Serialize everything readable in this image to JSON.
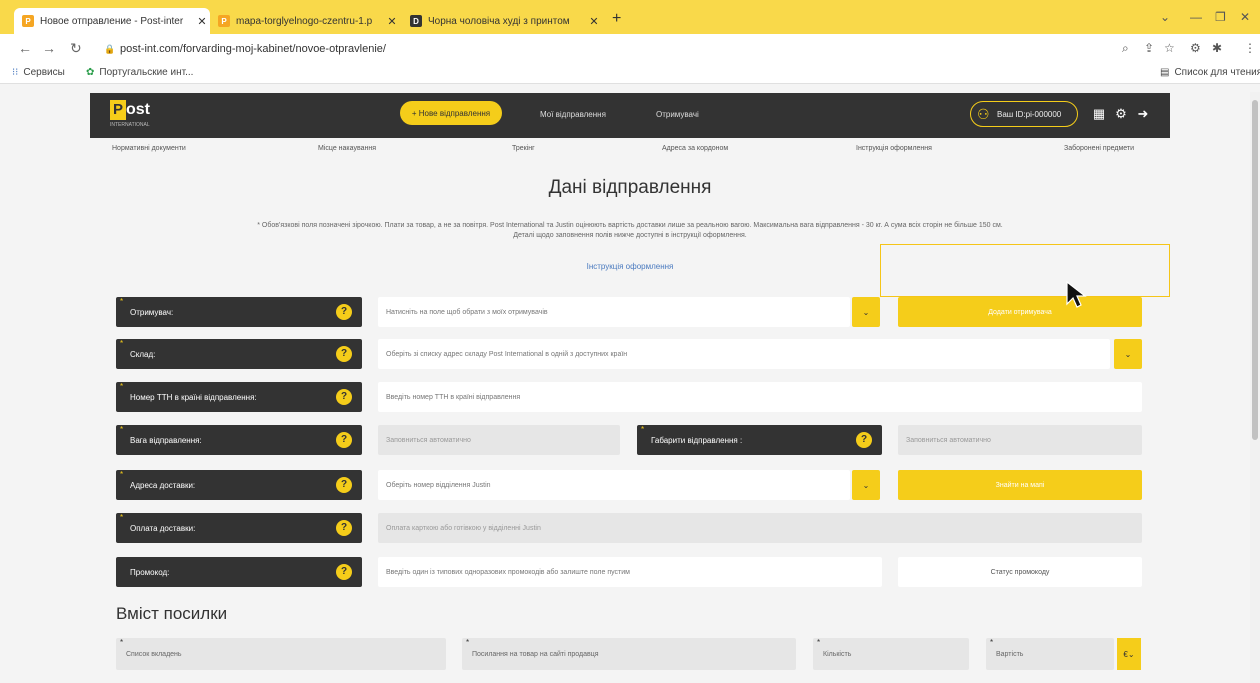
{
  "browser": {
    "tabs": [
      {
        "title": "Новое отправление - Post-inter",
        "favicon": "P"
      },
      {
        "title": "mapa-torglyelnogo-czentru-1.p",
        "favicon": "P"
      },
      {
        "title": "Чорна чоловіча худі з принтом",
        "favicon": "D"
      }
    ],
    "new_tab": "+",
    "url": "post-int.com/forvarding-moj-kabinet/novoe-otpravlenie/",
    "bookmarks": [
      {
        "label": "Сервисы"
      },
      {
        "label": "Португальские инт..."
      }
    ],
    "reading_list": "Список для чтения"
  },
  "site": {
    "logo_p": "P",
    "logo_rest": "ost",
    "logo_sub": "INTERNATIONAL",
    "nav_new": "+ Нове відправлення",
    "nav_mine": "Мої відправлення",
    "nav_received": "Отримувачі",
    "user_id": "Ваш ID:pi-000000",
    "subnav": [
      "Нормативні документи",
      "Місце накаування",
      "Трекінг",
      "Адреса за кордоном",
      "Інструкція оформлення",
      "Заборонені предмети"
    ]
  },
  "page": {
    "title": "Дані відправлення",
    "notice_line1": "* Обов'язкові поля позначені зірочкою. Плати за товар, а не за повітря. Post International та Justin оцінюють вартість доставки лише за реальною вагою. Максимальна вага відправлення - 30 кг. А сума всіх сторін не більше 150 см.",
    "notice_line2": "Деталі щодо заповнення полів нижче доступні в інструкції оформлення.",
    "instructions_link": "Інструкція оформлення"
  },
  "form": {
    "recipient_label": "Отримувач:",
    "recipient_placeholder": "Натисніть на поле щоб обрати з моїх отримувачів",
    "add_recipient": "Додати отримувача",
    "warehouse_label": "Склад:",
    "warehouse_placeholder": "Оберіть зі списку адрес складу Post International в одній з доступних країн",
    "ttn_label": "Номер ТТН в країні відправлення:",
    "ttn_placeholder": "Введіть номер ТТН в країні відправлення",
    "weight_label": "Вага відправлення:",
    "weight_placeholder": "Заповниться автоматично",
    "dims_label": "Габарити відправлення :",
    "dims_placeholder": "Заповниться автоматично",
    "address_label": "Адреса доставки:",
    "address_placeholder": "Оберіть номер відділення Justin",
    "find_on_map": "Знайти на мапі",
    "payment_label": "Оплата доставки:",
    "payment_placeholder": "Оплата карткою або готівкою у відділенні Justin",
    "promo_label": "Промокод:",
    "promo_placeholder": "Введіть один із типових одноразових промокодів або залиште поле пустим",
    "promo_status": "Статус промокоду",
    "help_icon": "?"
  },
  "parcel": {
    "title": "Вміст посилки",
    "items_label": "Список вкладень",
    "link_label": "Посилання на товар на сайті продавця",
    "qty_label": "Кількість",
    "price_label": "Вартість",
    "currency": "€"
  }
}
